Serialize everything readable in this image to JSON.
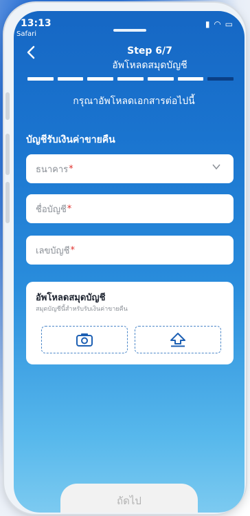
{
  "status_bar": {
    "time": "13:13",
    "browser": "Safari"
  },
  "header": {
    "step": "Step 6/7",
    "title": "อัพโหลดสมุดบัญชี"
  },
  "progress": {
    "total": 7,
    "current": 6
  },
  "instruction": "กรุณาอัพโหลดเอกสารต่อไปนี้",
  "section_title": "บัญชีรับเงินค่าขายคืน",
  "form": {
    "bank": {
      "placeholder": "ธนาคาร",
      "required_mark": "*"
    },
    "account_name": {
      "placeholder": "ชื่อบัญชี",
      "required_mark": "*"
    },
    "account_number": {
      "placeholder": "เลขบัญชี",
      "required_mark": "*"
    }
  },
  "upload": {
    "title": "อัพโหลดสมุดบัญชี",
    "description": "สมุดบัญชีนี้สำหรับรับเงินค่าขายคืน",
    "camera_icon": "camera-icon",
    "upload_icon": "upload-icon"
  },
  "next_button": "ถัดไป",
  "colors": {
    "primary": "#1667c4",
    "accent": "#0a3f86",
    "required": "#e0302c"
  }
}
